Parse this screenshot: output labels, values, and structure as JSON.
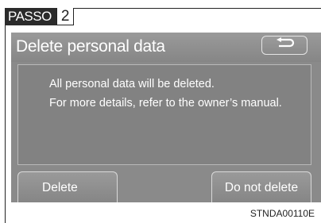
{
  "tag": {
    "brand": "PASSO",
    "number": "2"
  },
  "screen": {
    "title": "Delete personal data",
    "back_icon": "return-arrow-icon",
    "message": {
      "line1": "All personal data will be deleted.",
      "line2": "For more details, refer to the owner’s manual."
    },
    "buttons": {
      "delete_label": "Delete",
      "keep_label": "Do not delete"
    }
  },
  "figure_code": "STNDA00110E",
  "colors": {
    "screen_bg": "#8a8a8a",
    "text": "#ffffff",
    "tag_bg": "#2b2b2b"
  }
}
